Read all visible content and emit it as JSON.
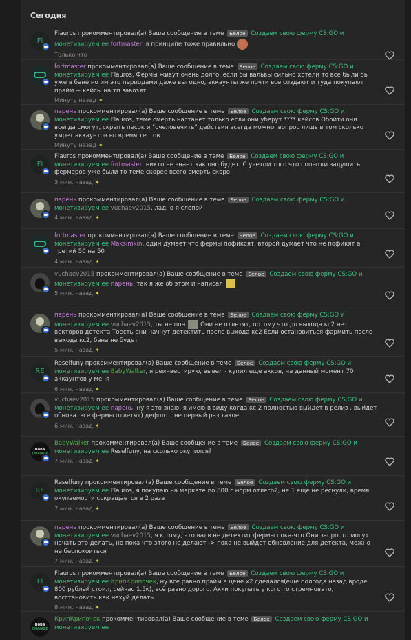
{
  "section_title": "Сегодня",
  "tag_label": "Белое",
  "thread_title": "Создаем свою ферму CS:GO и монетизируем ее",
  "action_text": "прокомментировал(а) Ваше сообщение в теме",
  "items": [
    {
      "actor": "Flauros",
      "quoted": "fortmaster",
      "message": ", в принципе тоже правильно",
      "time": "Только что",
      "star": false
    },
    {
      "actor": "fortmaster",
      "quoted": "Flauros",
      "message": ", Фермы живут очень долго, если бы вальвы сильно хотели то все были бы уже в бане но им это периодами даже выгодно, аккаунты же почти все создают и туда покупают прайм + кейсы на тп завозят",
      "time": "Минуту назад",
      "star": true
    },
    {
      "actor": "парень",
      "quoted": "Flauros",
      "message": ", теме смерть настанет только если они уберут **** кейсов Обойти они всегда смогут, скрыть песок и \"очеловечить\" действия всегда можно, вопрос лишь в том сколько умрет аккаунтов во время тестов",
      "time": "Минуту назад",
      "star": true
    },
    {
      "actor": "Flauros",
      "quoted": "fortmaster",
      "message": ", никто не знает как оно будет. С учетом того что попытки задушить фермеров уже были то теме скорее всего смерть скоро",
      "time": "3 мин. назад",
      "star": true
    },
    {
      "actor": "парень",
      "quoted": "vuchaev2015",
      "message": ", ладно я слепой",
      "time": "4 мин. назад",
      "star": true
    },
    {
      "actor": "fortmaster",
      "quoted": "Maksimkin",
      "message": ", один думает что фермы пофиксят, второй думает что не пофикят а третий 50 на 50",
      "time": "4 мин. назад",
      "star": true
    },
    {
      "actor": "vuchaev2015",
      "quoted": "парень",
      "message": ", так я же об этом и написал",
      "time": "5 мин. назад",
      "star": true
    },
    {
      "actor": "парень",
      "quoted": "vuchaev2015",
      "message": ", ты не пон",
      "message2": "Они не отлетят, потому что до выхода кс2 нет векторов детекта Тоесть они начнут детектить после выхода кс2 Если остановиться фармить после выхода кс2, бана не будет",
      "time": "5 мин. назад",
      "star": true
    },
    {
      "actor": "Reselfuny",
      "quoted": "BabyWalker",
      "message": ", я реинвестирую, вывел - купил еще акков, на данный момент 70 аккаунтов у меня",
      "time": "6 мин. назад",
      "star": true
    },
    {
      "actor": "vuchaev2015",
      "quoted": "парень",
      "message": ", ну я это знаю. я имею в виду когда кс 2 полностью выйдет в релиз , выйдет обнова. все фермы отлетят) дефолт , не первый раз такое",
      "time": "6 мин. назад",
      "star": true
    },
    {
      "actor": "BabyWalker",
      "quoted": "Reselfuny",
      "message": ", на сколько окупился?",
      "time": "7 мин. назад",
      "star": true
    },
    {
      "actor": "Reselfuny",
      "quoted": "Flauros",
      "message": ", я покупаю на маркете по 800 с норм отлегой, не 1 еще не реснули, время окупаемости сокращается в 2 раза",
      "time": "7 мин. назад",
      "star": true
    },
    {
      "actor": "парень",
      "quoted": "vuchaev2015",
      "message": ", я к тому, что валв не детектит фермы пока-что Они запросто могут начать это делать, но пока что этого не делают -> пока не выйдет обновление для детекта, можно не беспокоиться",
      "time": "7 мин. назад",
      "star": true
    },
    {
      "actor": "Flauros",
      "quoted": "КрипКрипочек",
      "message": ", ну все равно прайм в цене х2 сделался(еще полгода назад вроде 800 рублей стоил, сейчас 1.5к), всё равно дорого. Акки покупать у кого то стремновато, восстановить как нехуй делать",
      "time": "8 мин. назад",
      "star": true
    },
    {
      "actor": "КрипКрипочек",
      "quoted": "",
      "message": "",
      "time": "",
      "star": false
    }
  ],
  "avatars": {
    "fl": "Fl",
    "re": "RE",
    "logo_top": "BoBa",
    "logo_bottom": "CHANGE"
  }
}
